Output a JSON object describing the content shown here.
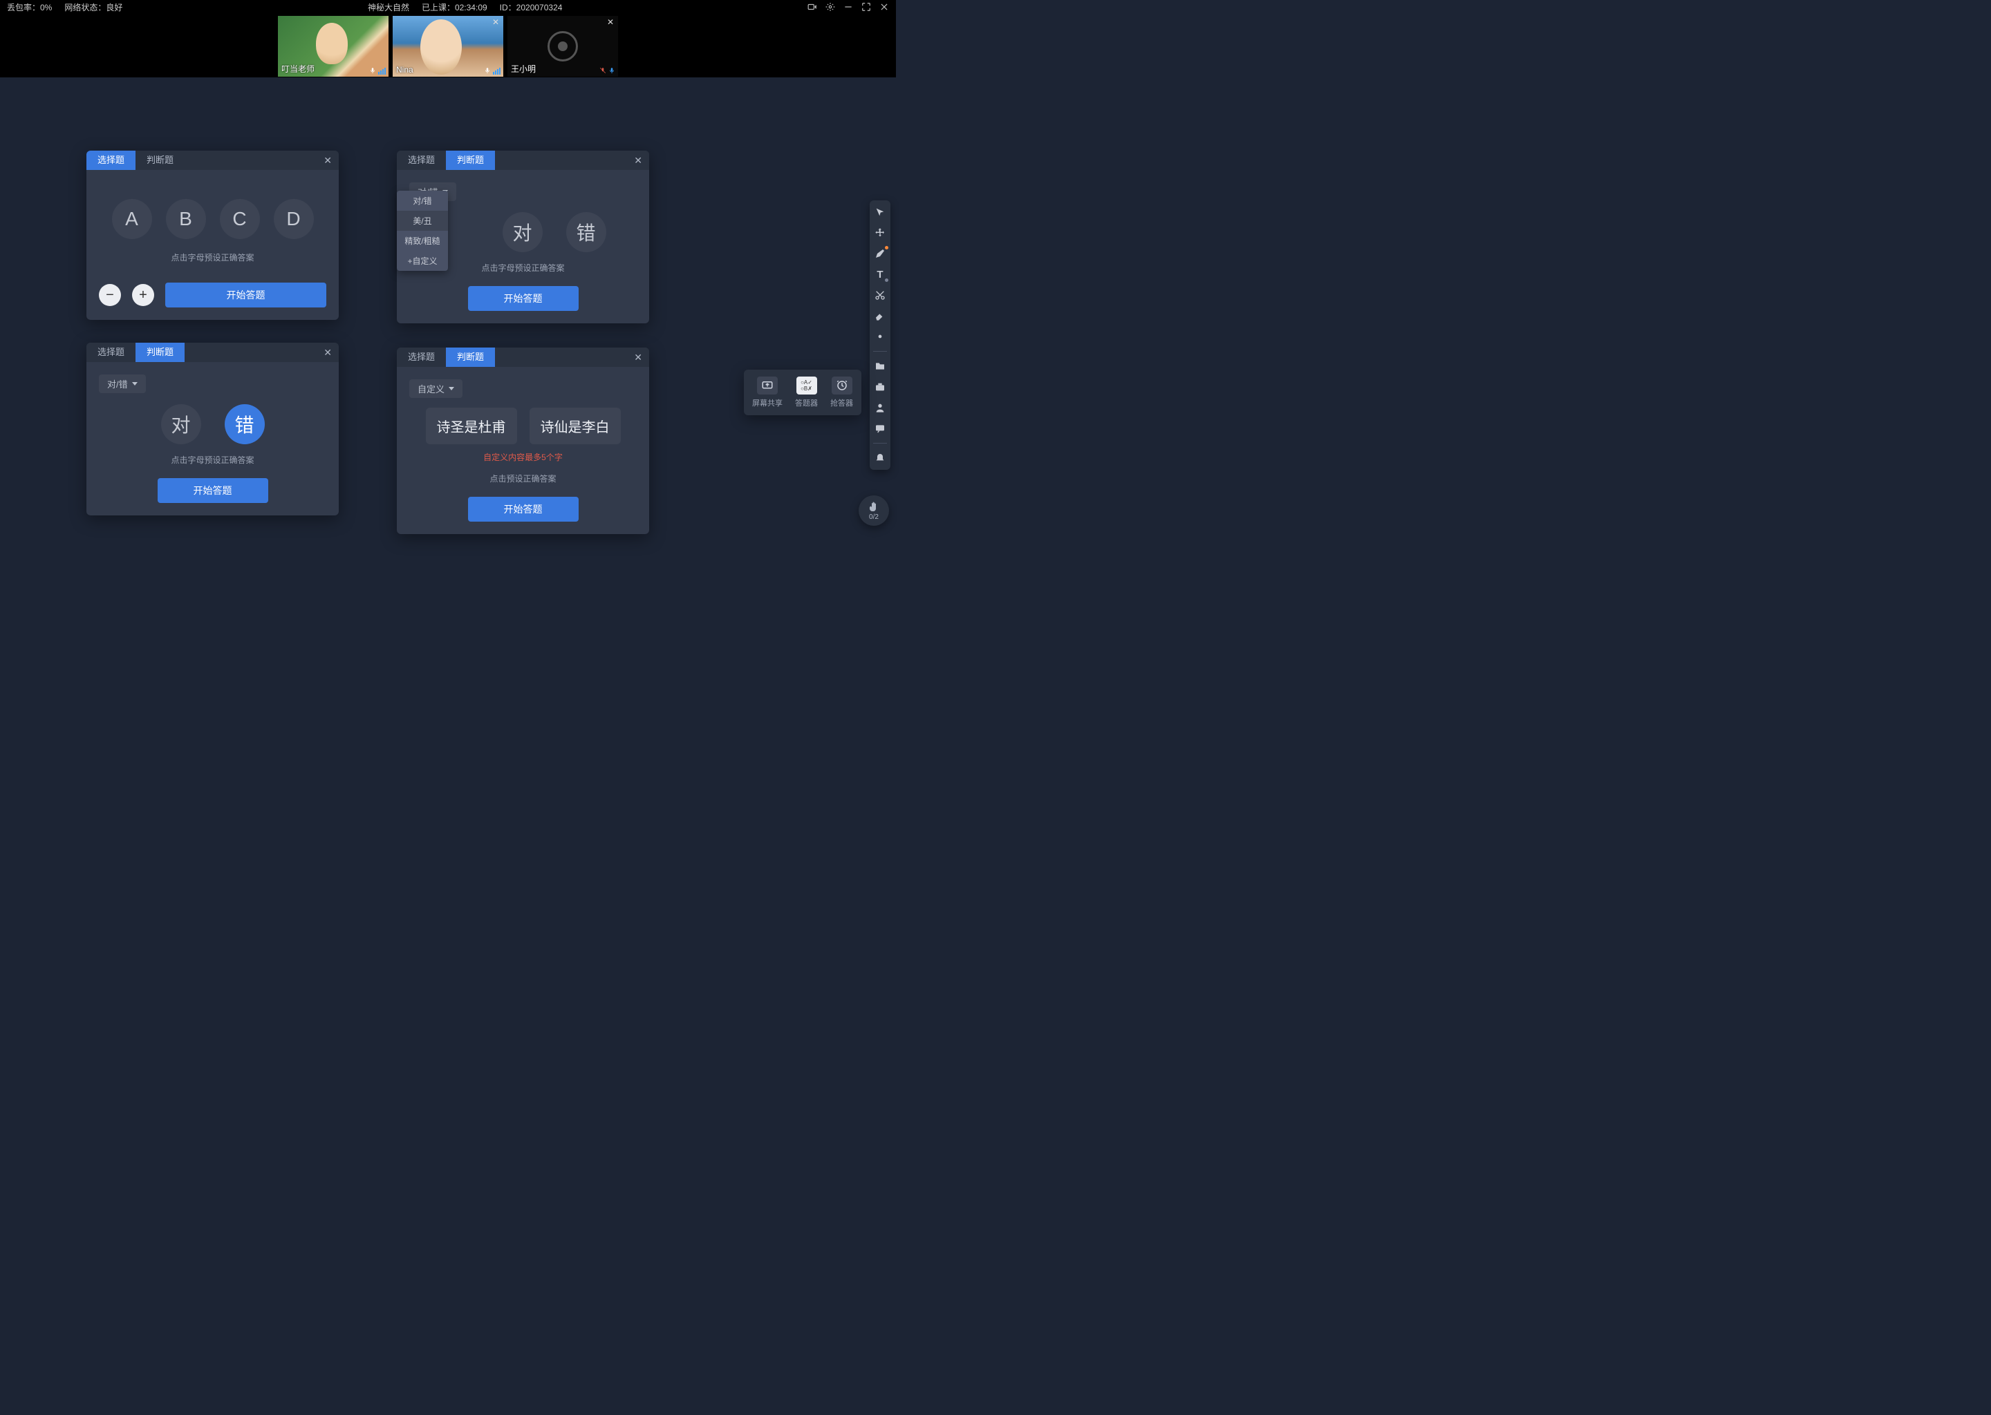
{
  "topbar": {
    "packet_loss": "丢包率：0%",
    "network": "网络状态：良好",
    "title": "神秘大自然",
    "elapsed": "已上课：02:34:09",
    "session_id": "ID：2020070324"
  },
  "videos": {
    "tiles": [
      {
        "name": "叮当老师",
        "is_you": true,
        "cam_on": true
      },
      {
        "name": "Nina",
        "is_you": false,
        "cam_on": true
      },
      {
        "name": "王小明",
        "is_you": false,
        "cam_on": false,
        "muted": true
      }
    ]
  },
  "common": {
    "tab_mc": "选择题",
    "tab_tf": "判断题",
    "start": "开始答题",
    "hint_letters": "点击字母预设正确答案",
    "hint_preset": "点击预设正确答案",
    "dd_label_tf": "对/错",
    "dd_label_custom": "自定义",
    "dd_options": [
      "对/错",
      "美/丑",
      "精致/粗糙",
      "+自定义"
    ]
  },
  "panel1": {
    "options": [
      "A",
      "B",
      "C",
      "D"
    ]
  },
  "panel2": {
    "t": "对",
    "f": "错"
  },
  "panel3": {
    "t": "对",
    "f": "错"
  },
  "panel4": {
    "opt1": "诗圣是杜甫",
    "opt2": "诗仙是李白",
    "limit": "自定义内容最多5个字"
  },
  "popup": {
    "share": "屏幕共享",
    "answer": "答题器",
    "rush": "抢答器"
  },
  "hand": {
    "count": "0/2"
  }
}
